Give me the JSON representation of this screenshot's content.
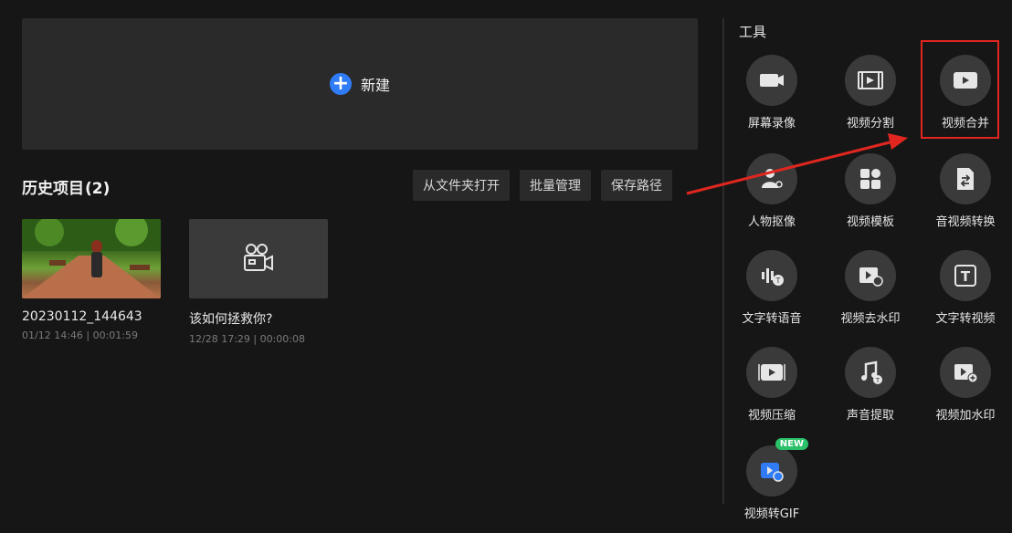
{
  "new_project": {
    "label": "新建"
  },
  "history": {
    "title": "历史项目",
    "count": "(2)",
    "actions": [
      "从文件夹打开",
      "批量管理",
      "保存路径"
    ],
    "projects": [
      {
        "name": "20230112_144643",
        "meta": "01/12 14:46 | 00:01:59",
        "thumb": "photo"
      },
      {
        "name": "该如何拯救你?",
        "meta": "12/28 17:29 | 00:00:08",
        "thumb": "video-camera-icon"
      }
    ]
  },
  "tools": {
    "title": "工具",
    "items": [
      {
        "label": "屏幕录像",
        "icon": "screen-record-icon"
      },
      {
        "label": "视频分割",
        "icon": "video-split-icon"
      },
      {
        "label": "视频合并",
        "icon": "video-merge-icon",
        "highlighted": true
      },
      {
        "label": "人物抠像",
        "icon": "person-cutout-icon"
      },
      {
        "label": "视频模板",
        "icon": "video-template-icon"
      },
      {
        "label": "音视频转换",
        "icon": "av-convert-icon"
      },
      {
        "label": "文字转语音",
        "icon": "text-to-speech-icon"
      },
      {
        "label": "视频去水印",
        "icon": "remove-watermark-icon"
      },
      {
        "label": "文字转视频",
        "icon": "text-to-video-icon"
      },
      {
        "label": "视频压缩",
        "icon": "video-compress-icon"
      },
      {
        "label": "声音提取",
        "icon": "audio-extract-icon"
      },
      {
        "label": "视频加水印",
        "icon": "add-watermark-icon"
      },
      {
        "label": "视频转GIF",
        "icon": "video-to-gif-icon",
        "badge": "NEW"
      }
    ]
  },
  "colors": {
    "accent": "#2f7cf6",
    "annotation": "#e0261f",
    "badge": "#2bc06a"
  }
}
